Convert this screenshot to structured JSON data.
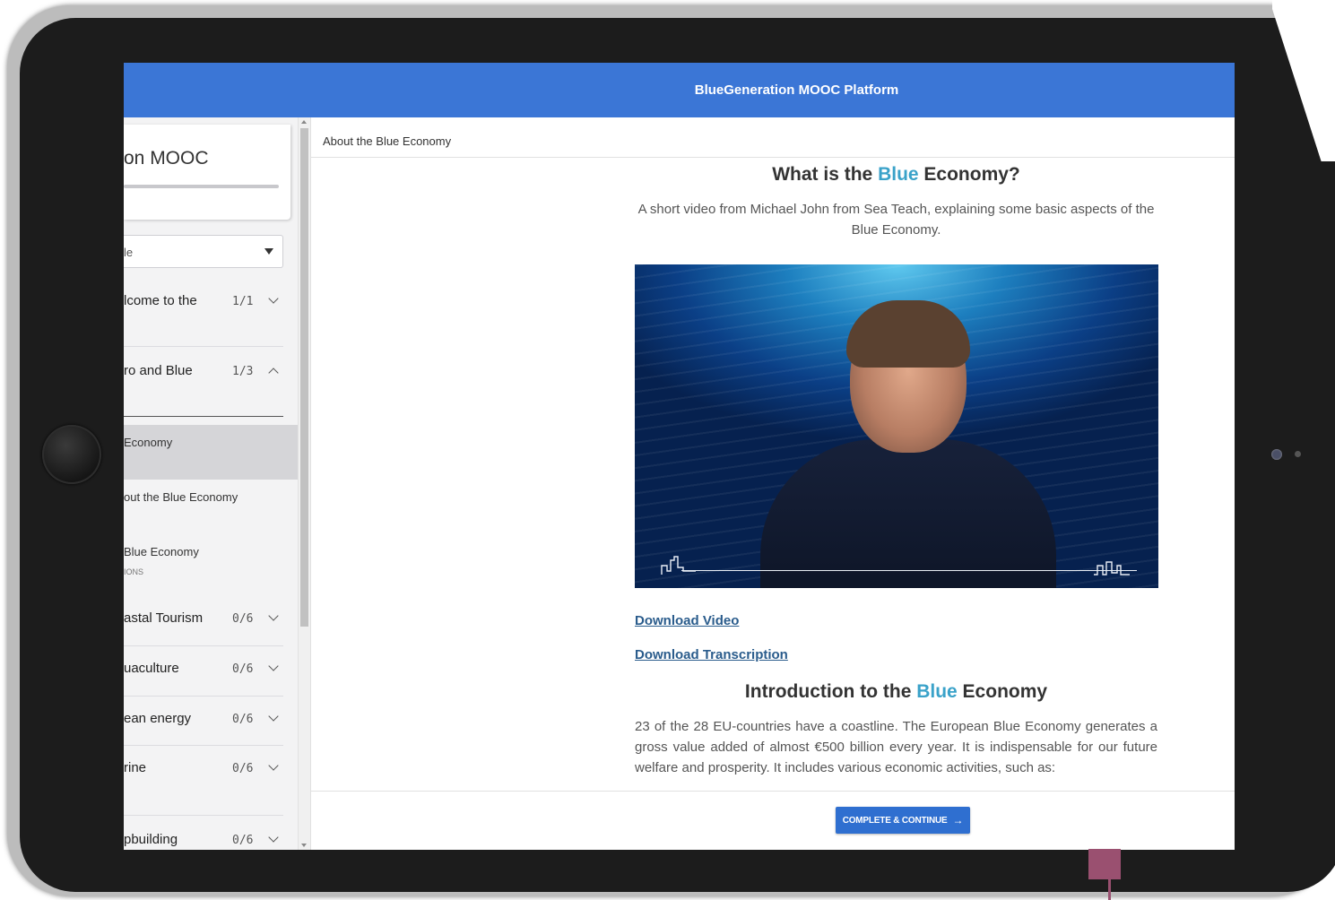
{
  "app": {
    "title": "BlueGeneration MOOC Platform"
  },
  "sidebar": {
    "course_title": "on MOOC",
    "module_select": "le",
    "sections": [
      {
        "label": "lcome to the",
        "count": "1/1",
        "state": "collapsed"
      },
      {
        "label": "ro and Blue",
        "count": "1/3",
        "state": "expanded"
      },
      {
        "label": "astal Tourism",
        "count": "0/6",
        "state": "collapsed"
      },
      {
        "label": "uaculture",
        "count": "0/6",
        "state": "collapsed"
      },
      {
        "label": "ean energy",
        "count": "0/6",
        "state": "collapsed"
      },
      {
        "label": "rine",
        "count": "0/6",
        "state": "collapsed"
      },
      {
        "label": "pbuilding",
        "count": "0/6",
        "state": "collapsed"
      }
    ],
    "lessons": [
      {
        "label": "Economy",
        "sub": "",
        "active": true
      },
      {
        "label": "out the Blue Economy",
        "sub": "",
        "active": false
      },
      {
        "label": "Blue Economy",
        "sub": "IONS",
        "active": false
      }
    ]
  },
  "content": {
    "lesson_title": "About the Blue Economy",
    "heading1": {
      "pre": "What is the ",
      "accent": "Blue",
      "post": " Economy?"
    },
    "intro": "A short video from Michael John from Sea Teach, explaining some basic aspects of the Blue Economy.",
    "download_video": "Download Video",
    "download_transcription": "Download Transcription",
    "heading2": {
      "pre": "Introduction to the ",
      "accent": "Blue",
      "post": " Economy"
    },
    "body": "23 of the 28 EU-countries have a coastline. The European Blue Economy generates a gross value added of almost €500 billion every year. It is indispensable for our future welfare and prosperity. It includes various economic activities, such as:",
    "complete_button": "COMPLETE & CONTINUE",
    "arrow": "→"
  },
  "colors": {
    "topbar": "#3b76d6",
    "accent": "#3aa2c9",
    "button": "#2f6fd0"
  }
}
